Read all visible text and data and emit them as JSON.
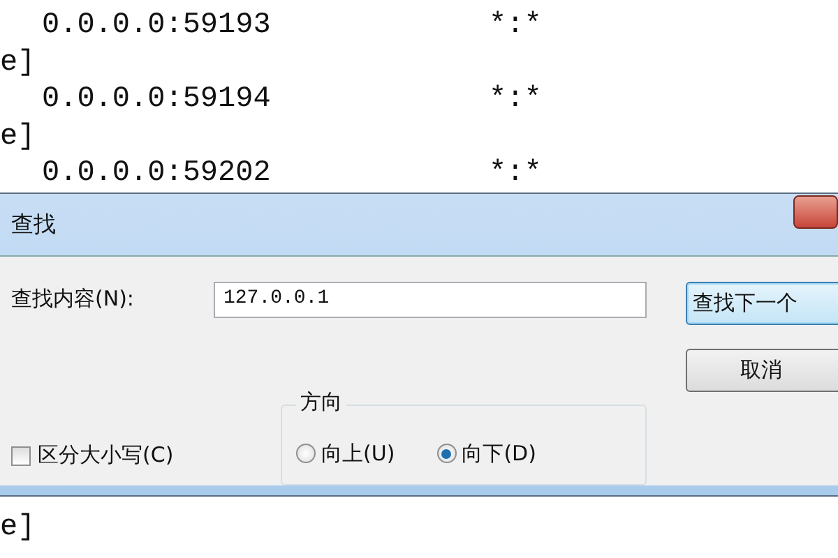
{
  "background_text": {
    "top_lines": [
      {
        "kind": "address",
        "address": "0.0.0.0:59193",
        "foreign": "*:*"
      },
      {
        "kind": "tail",
        "text": "e]"
      },
      {
        "kind": "address",
        "address": "0.0.0.0:59194",
        "foreign": "*:*"
      },
      {
        "kind": "tail",
        "text": "e]"
      },
      {
        "kind": "address",
        "address": "0.0.0.0:59202",
        "foreign": "*:*"
      }
    ],
    "bottom_lines": [
      {
        "kind": "tail",
        "text": "e]"
      }
    ]
  },
  "dialog": {
    "title": "查找",
    "find_label": "查找内容(N):",
    "find_value": "127.0.0.1",
    "buttons": [
      {
        "label": "查找下一个",
        "default": true
      },
      {
        "label": "取消",
        "default": false
      }
    ],
    "direction": {
      "label": "方向",
      "options": [
        {
          "label": "向上(U)",
          "selected": false
        },
        {
          "label": "向下(D)",
          "selected": true
        }
      ]
    },
    "match_case": {
      "label": "区分大小写(C)",
      "checked": false
    }
  }
}
